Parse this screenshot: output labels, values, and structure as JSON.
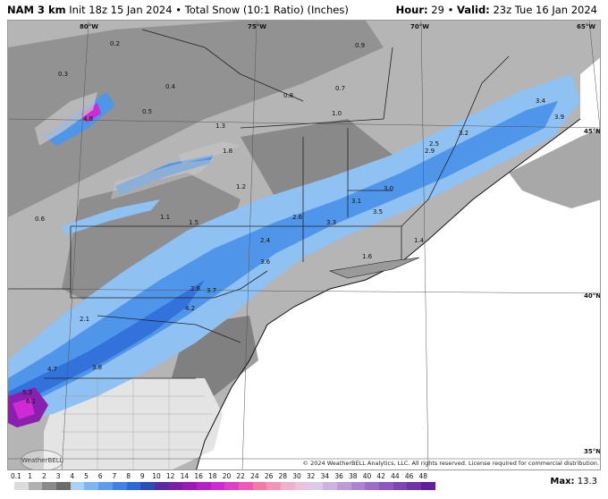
{
  "header": {
    "model": "NAM 3 km",
    "init": "Init 18z 15 Jan 2024",
    "sep": "•",
    "field": "Total Snow (10:1 Ratio) (Inches)",
    "hour_label": "Hour:",
    "hour": "29",
    "valid_label": "Valid:",
    "valid": "23z Tue 16 Jan 2024"
  },
  "map": {
    "coord_labels": [
      "80°W",
      "75°W",
      "70°W",
      "65°W",
      "45°N",
      "40°N",
      "35°N"
    ],
    "snow_values": [
      {
        "v": "0.2"
      },
      {
        "v": "0.3"
      },
      {
        "v": "0.4"
      },
      {
        "v": "0.5"
      },
      {
        "v": "0.8"
      },
      {
        "v": "1.3"
      },
      {
        "v": "1.2"
      },
      {
        "v": "0.9"
      },
      {
        "v": "0.7"
      },
      {
        "v": "1.0"
      },
      {
        "v": "3.4"
      },
      {
        "v": "3.9"
      },
      {
        "v": "3.2"
      },
      {
        "v": "2.9"
      },
      {
        "v": "2.5"
      },
      {
        "v": "3.0"
      },
      {
        "v": "3.3"
      },
      {
        "v": "3.5"
      },
      {
        "v": "3.1"
      },
      {
        "v": "2.6"
      },
      {
        "v": "1.6"
      },
      {
        "v": "1.4"
      },
      {
        "v": "1.5"
      },
      {
        "v": "3.7"
      },
      {
        "v": "3.6"
      },
      {
        "v": "2.8"
      },
      {
        "v": "2.4"
      },
      {
        "v": "4.2"
      },
      {
        "v": "2.1"
      },
      {
        "v": "4.7"
      },
      {
        "v": "3.8"
      },
      {
        "v": "5.3"
      },
      {
        "v": "6.1"
      },
      {
        "v": "4.8"
      },
      {
        "v": "1.8"
      },
      {
        "v": "1.1"
      },
      {
        "v": "0.6"
      }
    ],
    "logo_text": "WeatherBELL",
    "colors": {
      "land_light": "#b5b5b5",
      "land_mid": "#8c8c8c",
      "land_dark": "#5e5e5e",
      "snow_light_blue": "#8fc1f2",
      "snow_blue": "#4f95ea",
      "snow_dark_blue": "#2b69d6",
      "snow_purple": "#8a1fb0",
      "snow_magenta": "#d02ad5",
      "ocean": "#ffffff"
    }
  },
  "copyright": "© 2024 WeatherBELL Analytics, LLC. All rights reserved. License required for commercial distribution.",
  "legend": {
    "ticks": [
      "0.1",
      "1",
      "2",
      "3",
      "4",
      "5",
      "6",
      "7",
      "8",
      "9",
      "10",
      "12",
      "14",
      "16",
      "18",
      "20",
      "22",
      "24",
      "26",
      "28",
      "30",
      "32",
      "34",
      "36",
      "38",
      "40",
      "42",
      "44",
      "46",
      "48"
    ],
    "colors": [
      "#dcdcdc",
      "#b0b0b0",
      "#8a8a8a",
      "#6c6c6c",
      "#a8d1f7",
      "#7fb6f0",
      "#5c9cea",
      "#3f82e0",
      "#2b69d6",
      "#2b4fb8",
      "#5a2aa0",
      "#7a1fa8",
      "#9a1ab8",
      "#b51fc6",
      "#cf2ad6",
      "#e040c8",
      "#ee5ab8",
      "#f37aa8",
      "#f495b8",
      "#f1b0cc",
      "#e9c2dd",
      "#dccbe8",
      "#cdb4e0",
      "#bd9bd8",
      "#ad84cf",
      "#9e6dc7",
      "#8f58be",
      "#8045b4",
      "#7033a8",
      "#611f9c"
    ]
  },
  "max": {
    "label": "Max:",
    "value": "13.3"
  }
}
